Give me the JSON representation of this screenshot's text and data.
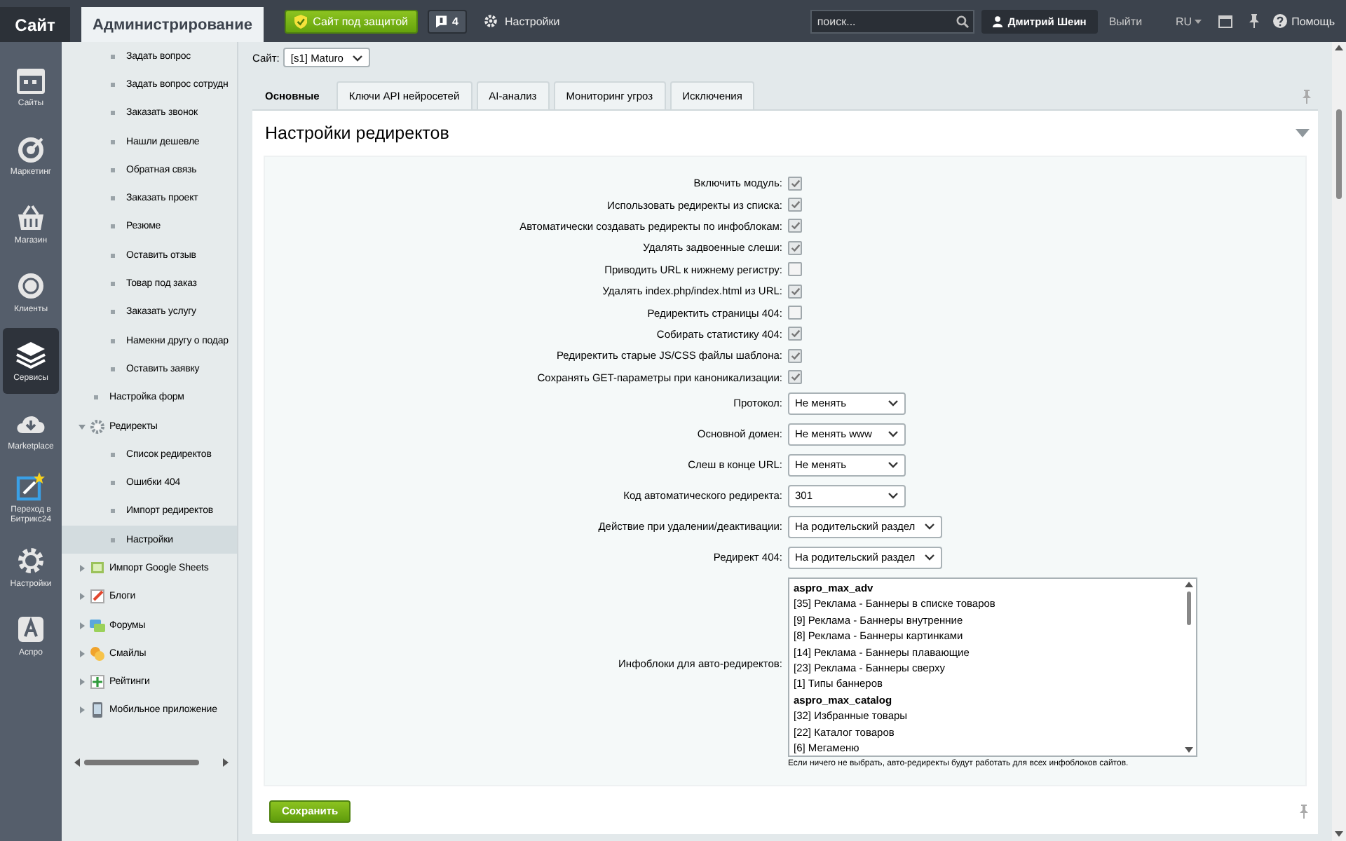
{
  "topbar": {
    "tabs": [
      {
        "label": "Сайт",
        "selected": false
      },
      {
        "label": "Администрирование",
        "selected": true
      }
    ],
    "protection_button": "Сайт под защитой",
    "notifications_count": "4",
    "settings_link": "Настройки",
    "search": {
      "placeholder": "поиск..."
    },
    "user": "Дмитрий Шеин",
    "logout": "Выйти",
    "language": "RU",
    "help": "Помощь"
  },
  "rail": {
    "items": [
      {
        "label": "Сайты",
        "selected": false
      },
      {
        "label": "Маркетинг",
        "selected": false
      },
      {
        "label": "Магазин",
        "selected": false
      },
      {
        "label": "Клиенты",
        "selected": false
      },
      {
        "label": "Сервисы",
        "selected": true
      },
      {
        "label": "Marketplace",
        "selected": false
      },
      {
        "label": "Переход в Битрикс24",
        "selected": false
      },
      {
        "label": "Настройки",
        "selected": false
      },
      {
        "label": "Аспро",
        "selected": false
      }
    ]
  },
  "tree": {
    "items": [
      {
        "children": [
          {
            "children": [
              {
                "label": "Задать вопрос",
                "selected": false
              },
              {
                "label": "Задать вопрос сотрудн",
                "selected": false
              },
              {
                "label": "Заказать звонок",
                "selected": false
              },
              {
                "label": "Нашли дешевле",
                "selected": false
              },
              {
                "label": "Обратная связь",
                "selected": false
              },
              {
                "label": "Заказать проект",
                "selected": false
              },
              {
                "label": "Резюме",
                "selected": false
              },
              {
                "label": "Оставить отзыв",
                "selected": false
              },
              {
                "label": "Товар под заказ",
                "selected": false
              },
              {
                "label": "Заказать услугу",
                "selected": false
              },
              {
                "label": "Намекни другу о подар",
                "selected": false
              },
              {
                "label": "Оставить заявку",
                "selected": false
              }
            ]
          },
          {
            "label": "Настройка форм",
            "selected": false
          },
          {
            "label": "Редиректы",
            "selected": false,
            "expanded": true,
            "children": [
              {
                "label": "Список редиректов",
                "selected": false
              },
              {
                "label": "Ошибки 404",
                "selected": false
              },
              {
                "label": "Импорт редиректов",
                "selected": false
              },
              {
                "label": "Настройки",
                "selected": true
              }
            ]
          }
        ]
      },
      {
        "label": "Импорт Google Sheets",
        "selected": false,
        "expanded": false
      },
      {
        "label": "Блоги",
        "selected": false,
        "expanded": false
      },
      {
        "label": "Форумы",
        "selected": false,
        "expanded": false
      },
      {
        "label": "Смайлы",
        "selected": false,
        "expanded": false
      },
      {
        "label": "Рейтинги",
        "selected": false,
        "expanded": false
      },
      {
        "label": "Мобильное приложение",
        "selected": false,
        "expanded": false
      }
    ]
  },
  "site_selector": {
    "label": "Сайт:",
    "value": "[s1] Maturo"
  },
  "tabs": [
    {
      "label": "Основные",
      "selected": true
    },
    {
      "label": "Ключи API нейросетей",
      "selected": false
    },
    {
      "label": "AI-анализ",
      "selected": false
    },
    {
      "label": "Мониторинг угроз",
      "selected": false
    },
    {
      "label": "Исключения",
      "selected": false
    }
  ],
  "section": {
    "title": "Настройки редиректов",
    "expanded": true,
    "fields": [
      {
        "kind": "checkbox",
        "label": "Включить модуль:",
        "checked": true
      },
      {
        "kind": "checkbox",
        "label": "Использовать редиректы из списка:",
        "checked": true
      },
      {
        "kind": "checkbox",
        "label": "Автоматически создавать редиректы по инфоблокам:",
        "checked": true
      },
      {
        "kind": "checkbox",
        "label": "Удалять задвоенные слеши:",
        "checked": true
      },
      {
        "kind": "checkbox",
        "label": "Приводить URL к нижнему регистру:",
        "checked": false
      },
      {
        "kind": "checkbox",
        "label": "Удалять index.php/index.html из URL:",
        "checked": true
      },
      {
        "kind": "checkbox",
        "label": "Редиректить страницы 404:",
        "checked": false
      },
      {
        "kind": "checkbox",
        "label": "Собирать статистику 404:",
        "checked": true
      },
      {
        "kind": "checkbox",
        "label": "Редиректить старые JS/CSS файлы шаблона:",
        "checked": true
      },
      {
        "kind": "checkbox",
        "label": "Сохранять GET-параметры при каноникализации:",
        "checked": true
      },
      {
        "kind": "select",
        "label": "Протокол:",
        "value": "Не менять"
      },
      {
        "kind": "select",
        "label": "Основной домен:",
        "value": "Не менять www"
      },
      {
        "kind": "select",
        "label": "Слеш в конце URL:",
        "value": "Не менять"
      },
      {
        "kind": "select",
        "label": "Код автоматического редиректа:",
        "value": "301"
      },
      {
        "kind": "select",
        "label": "Действие при удалении/деактивации:",
        "value": "На родительский раздел"
      },
      {
        "kind": "select",
        "label": "Редирект 404:",
        "value": "На родительский раздел"
      },
      {
        "kind": "listbox",
        "label": "Инфоблоки для авто-редиректов:",
        "hint": "Если ничего не выбрать, авто-редиректы будут работать для всех инфоблоков сайтов.",
        "items": [
          {
            "kind": "group",
            "text": "aspro_max_adv"
          },
          {
            "kind": "option",
            "text": "[35] Реклама - Баннеры в списке товаров"
          },
          {
            "kind": "option",
            "text": "[9] Реклама - Баннеры внутренние"
          },
          {
            "kind": "option",
            "text": "[8] Реклама - Баннеры картинками"
          },
          {
            "kind": "option",
            "text": "[14] Реклама - Баннеры плавающие"
          },
          {
            "kind": "option",
            "text": "[23] Реклама - Баннеры сверху"
          },
          {
            "kind": "option",
            "text": "[1] Типы баннеров"
          },
          {
            "kind": "group",
            "text": "aspro_max_catalog"
          },
          {
            "kind": "option",
            "text": "[32] Избранные товары"
          },
          {
            "kind": "option",
            "text": "[22] Каталог товаров"
          },
          {
            "kind": "option",
            "text": "[6] Мегаменю"
          }
        ]
      }
    ]
  },
  "save_button": "Сохранить"
}
